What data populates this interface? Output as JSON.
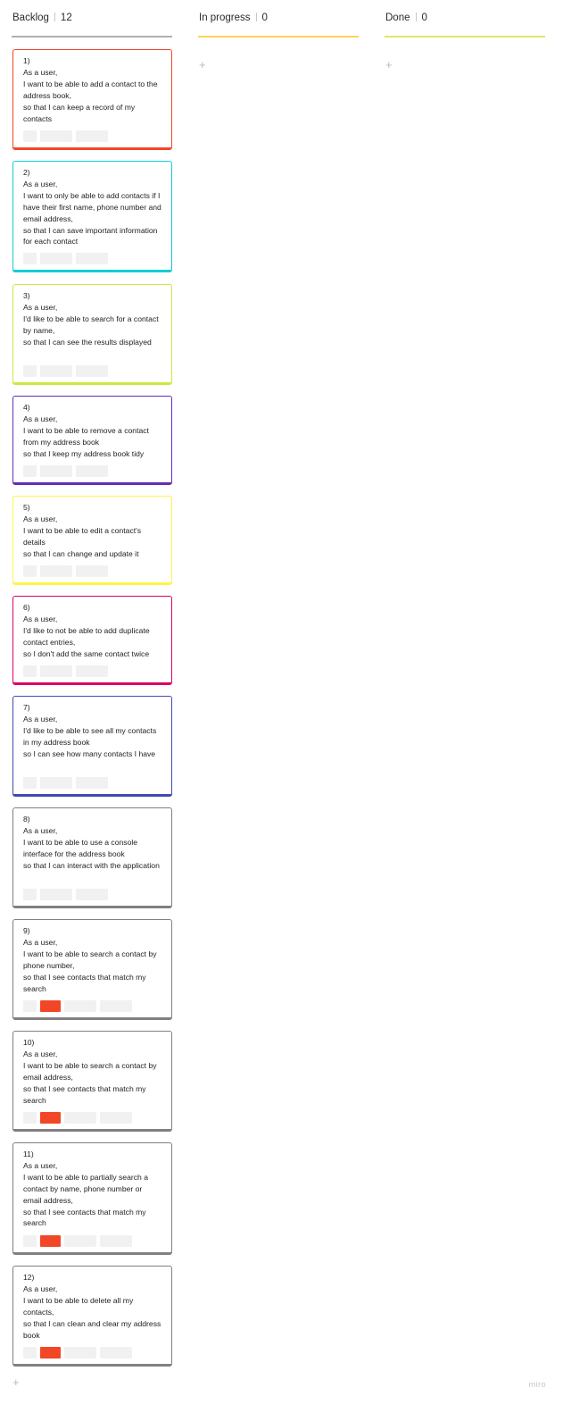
{
  "columns": [
    {
      "title": "Backlog",
      "count": "12",
      "line_color": "#b0b0b0"
    },
    {
      "title": "In progress",
      "count": "0",
      "line_color": "#ffd35a"
    },
    {
      "title": "Done",
      "count": "0",
      "line_color": "#dfe86a"
    }
  ],
  "add_symbol": "+",
  "watermark": "miro",
  "tag_color": "#f24726",
  "cards": [
    {
      "text": "1)\nAs a user,\nI want to be able to add a contact to the address book,\nso that I can keep a record of my contacts",
      "color": "#f24726",
      "tagged": false
    },
    {
      "text": "2)\nAs a user,\nI want to only be able to add contacts if I have their first name, phone number and email address,\nso that I can save important information for each contact",
      "color": "#12cdd4",
      "tagged": false
    },
    {
      "text": "3)\nAs a user,\nI'd like to be able to search for a contact by name,\nso that I can see the results displayed",
      "color": "#cee741",
      "tagged": false
    },
    {
      "text": "4)\nAs a user,\nI want to be able to remove a contact from my address book\nso that I keep my address book tidy",
      "color": "#652cb3",
      "tagged": false
    },
    {
      "text": "5)\nAs a user,\nI want to be able to edit a contact's details\nso that I can change and update it",
      "color": "#fef445",
      "tagged": false
    },
    {
      "text": "6)\nAs a user,\nI'd like to not be able to add duplicate contact entries,\nso I don't add the same contact twice",
      "color": "#da0063",
      "tagged": false
    },
    {
      "text": "7)\nAs a user,\nI'd like to be able to see all my contacts in my address book\nso I can see how many contacts I have",
      "color": "#414bb2",
      "tagged": false
    },
    {
      "text": "8)\nAs a user,\nI want to be able to use a console interface for the address book\nso that I can interact with the application",
      "color": "#808080",
      "tagged": false
    },
    {
      "text": "9)\nAs a user,\nI want to be able to search a contact by phone number,\nso that I see contacts that match my search",
      "color": "#808080",
      "tagged": true
    },
    {
      "text": "10)\nAs a user,\nI want to be able to search a contact by email address,\nso that I see contacts that match my search",
      "color": "#808080",
      "tagged": true
    },
    {
      "text": "11)\nAs a user,\nI want to be able to partially search a contact by name, phone number or email address,\nso that I see contacts that match my search",
      "color": "#808080",
      "tagged": true
    },
    {
      "text": "12)\nAs a user,\nI want to be able to delete all my contacts,\nso that I can clean and clear my address book",
      "color": "#808080",
      "tagged": true
    }
  ]
}
